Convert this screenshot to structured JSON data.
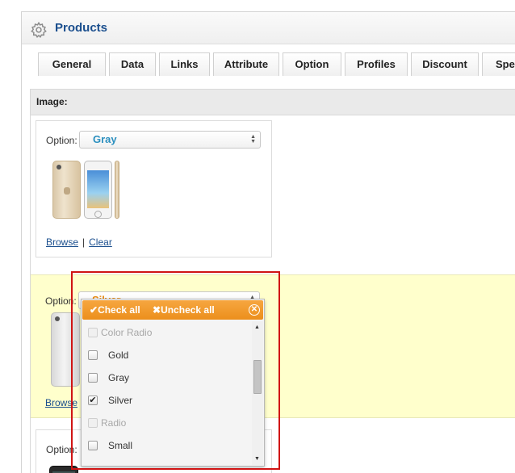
{
  "panel": {
    "title": "Products",
    "icon": "gear-icon"
  },
  "tabs": [
    "General",
    "Data",
    "Links",
    "Attribute",
    "Option",
    "Profiles",
    "Discount",
    "Spe"
  ],
  "image_section": {
    "heading": "Image:"
  },
  "options": [
    {
      "label": "Option:",
      "selected": "Gray",
      "color": "#2a8fbf",
      "browse": "Browse",
      "separator": "|",
      "clear": "Clear"
    },
    {
      "label": "Option:",
      "selected": "Silver",
      "color": "#e88a10",
      "browse": "Browse"
    },
    {
      "label": "Option:"
    }
  ],
  "dropdown": {
    "check_all": "Check all",
    "uncheck_all": "Uncheck all",
    "items": [
      {
        "text": "Color Radio",
        "group": true,
        "checked": false
      },
      {
        "text": "Gold",
        "group": false,
        "checked": false
      },
      {
        "text": "Gray",
        "group": false,
        "checked": false
      },
      {
        "text": "Silver",
        "group": false,
        "checked": true
      },
      {
        "text": "Radio",
        "group": true,
        "checked": false
      },
      {
        "text": "Small",
        "group": false,
        "checked": false
      }
    ]
  },
  "colors": {
    "accent_orange": "#ec8f1c",
    "title_blue": "#1b4f8e",
    "highlight": "#ffffcc",
    "annotation_red": "#d01414"
  }
}
